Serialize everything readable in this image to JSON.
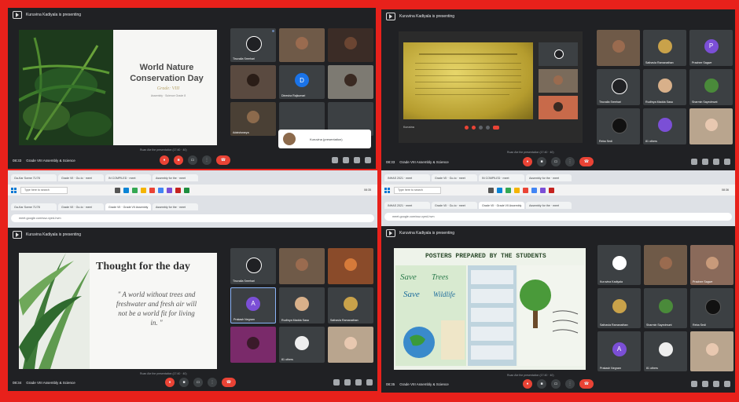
{
  "top_left": {
    "presenter": "Kuruvina Kadiyala is presenting",
    "slide": {
      "title_line1": "World Nature",
      "title_line2": "Conservation Day",
      "script_line": "Grade: VIII",
      "sub": "Assembly · Science Grade 8"
    },
    "tiles": [
      {
        "name": "Tiruvalla Sreehari"
      },
      {
        "name": ""
      },
      {
        "name": ""
      },
      {
        "name": ""
      },
      {
        "name": "Dinesha Rajkumari"
      },
      {
        "name": ""
      },
      {
        "name": "Adaishwarya"
      },
      {
        "name": ""
      },
      {
        "name": ""
      }
    ],
    "popup": "Kuruvina (presentation)",
    "caption": "Ruan Ate the presentation (17:40 · 40)",
    "time": "08:33",
    "meeting": "Grade VIII Assembly & Science"
  },
  "top_right": {
    "presenter": "Kuruvina Kadiyala is presenting",
    "slide_caption": "Kuruvina",
    "tiles": [
      {
        "name": ""
      },
      {
        "name": "Sathavla Ramanathan"
      },
      {
        "name": "Prachee Sagwe"
      },
      {
        "name": "Tiruvalla Sreehari"
      },
      {
        "name": "Rudhrya Madda Sasa"
      },
      {
        "name": "Sharmin Sayedmunt"
      },
      {
        "name": "Reba Sedi"
      },
      {
        "name": "81 others"
      },
      {
        "name": ""
      }
    ],
    "caption": "Ruan Ate the presentation (17:40 · 40)",
    "time": "08:33",
    "meeting": "Grade VIII Assembly & Science"
  },
  "bottom_left": {
    "presenter": "Kuruvina Kadiyala is presenting",
    "slide": {
      "title": "Thought for the day",
      "quote_line1": "\" A world without trees and",
      "quote_line2": "freshwater and fresh air will",
      "quote_line3": "not be a world fit for living",
      "quote_line4": "in. \""
    },
    "tiles": [
      {
        "name": "Tiruvalla Sreehari"
      },
      {
        "name": ""
      },
      {
        "name": ""
      },
      {
        "name": "Prakash Negram"
      },
      {
        "name": "Rudhrya Madda Sasa"
      },
      {
        "name": "Sathavla Ramanathan"
      },
      {
        "name": ""
      },
      {
        "name": "81 others"
      },
      {
        "name": ""
      }
    ],
    "caption": "Ruan Ate the presentation (17:40 · 40)",
    "time": "08:34",
    "meeting": "Grade VIII Assembly & Science"
  },
  "bottom_right": {
    "presenter": "Kuruvina Kadiyala is presenting",
    "slide": {
      "title": "Posters prepared by the students"
    },
    "tiles": [
      {
        "name": "Kuruvina Kadiyala"
      },
      {
        "name": ""
      },
      {
        "name": "Prachee Sagwe"
      },
      {
        "name": "Sathavla Ramanathan"
      },
      {
        "name": "Sharmin Sayedmunt"
      },
      {
        "name": "Reba Sedi"
      },
      {
        "name": "Prakash Negram"
      },
      {
        "name": "81 others"
      },
      {
        "name": ""
      }
    ],
    "caption": "Ruan Ate the presentation (17:40 · 40)",
    "time": "08:35",
    "meeting": "Grade VIII Assembly & Science"
  },
  "browser_left": {
    "tabs": [
      "Ga-Kar Scene 71/78",
      "Grade VII · Go-to · meet",
      "IN COMPILED · meet",
      "Assembly for the · meet",
      "Grade VII · Grade VII Assembly"
    ],
    "address": "meet.google.com/ssz-xyed-hvm",
    "search_placeholder": "Type here to search",
    "clock": "08:35"
  },
  "browser_right": {
    "tabs": [
      "INHAS 2021 · meet",
      "Grade VII · Go-to · meet",
      "IN COMPILED · meet",
      "Assembly for the · meet",
      "Grade VII · Grade VII Assembly"
    ],
    "address": "meet.google.com/ssz-xyed-hvm",
    "search_placeholder": "Type here to search",
    "clock": "08:36"
  }
}
